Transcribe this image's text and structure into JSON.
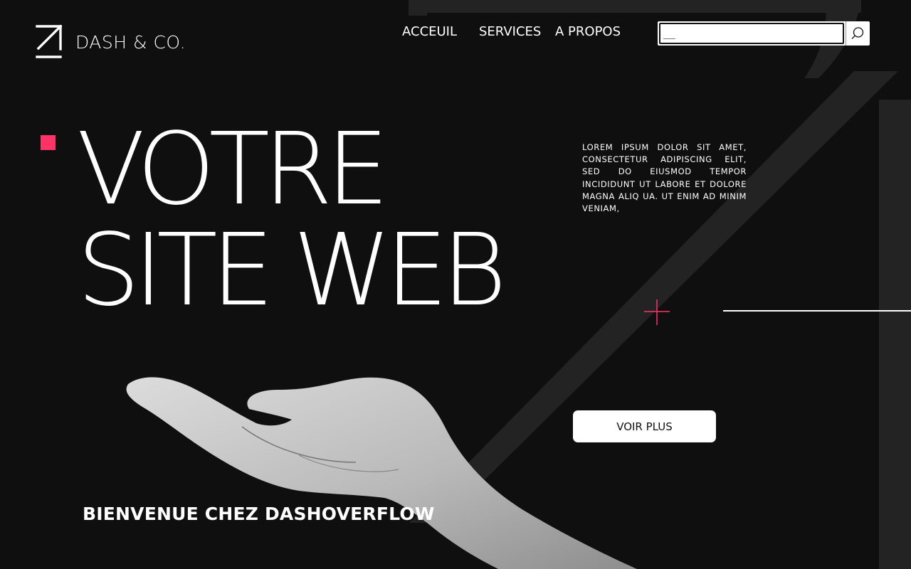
{
  "brand": {
    "name": "DASH & CO.",
    "logo_icon": "arrow-up-right-icon"
  },
  "nav": {
    "items": [
      {
        "label": "ACCEUIL"
      },
      {
        "label": "SERVICES"
      },
      {
        "label": "A PROPOS"
      }
    ]
  },
  "search": {
    "value": "__",
    "icon": "search-icon"
  },
  "hero": {
    "headline_line1": "VOTRE",
    "headline_line2": "SITE WEB",
    "intro": "LOREM IPSUM DOLOR SIT AMET, CONSECTETUR ADIPISCING ELIT, SED DO EIUSMOD TEMPOR INCIDIDUNT UT LABORE ET DOLORE MAGNA ALIQ UA. UT ENIM AD MINIM VENIAM,",
    "cta_label": "VOIR PLUS",
    "welcome": "BIENVENUE CHEZ DASHOVERFLOW"
  },
  "colors": {
    "background": "#0f0f10",
    "accent": "#ff3366",
    "text": "#ffffff",
    "watermark": "#232323"
  }
}
